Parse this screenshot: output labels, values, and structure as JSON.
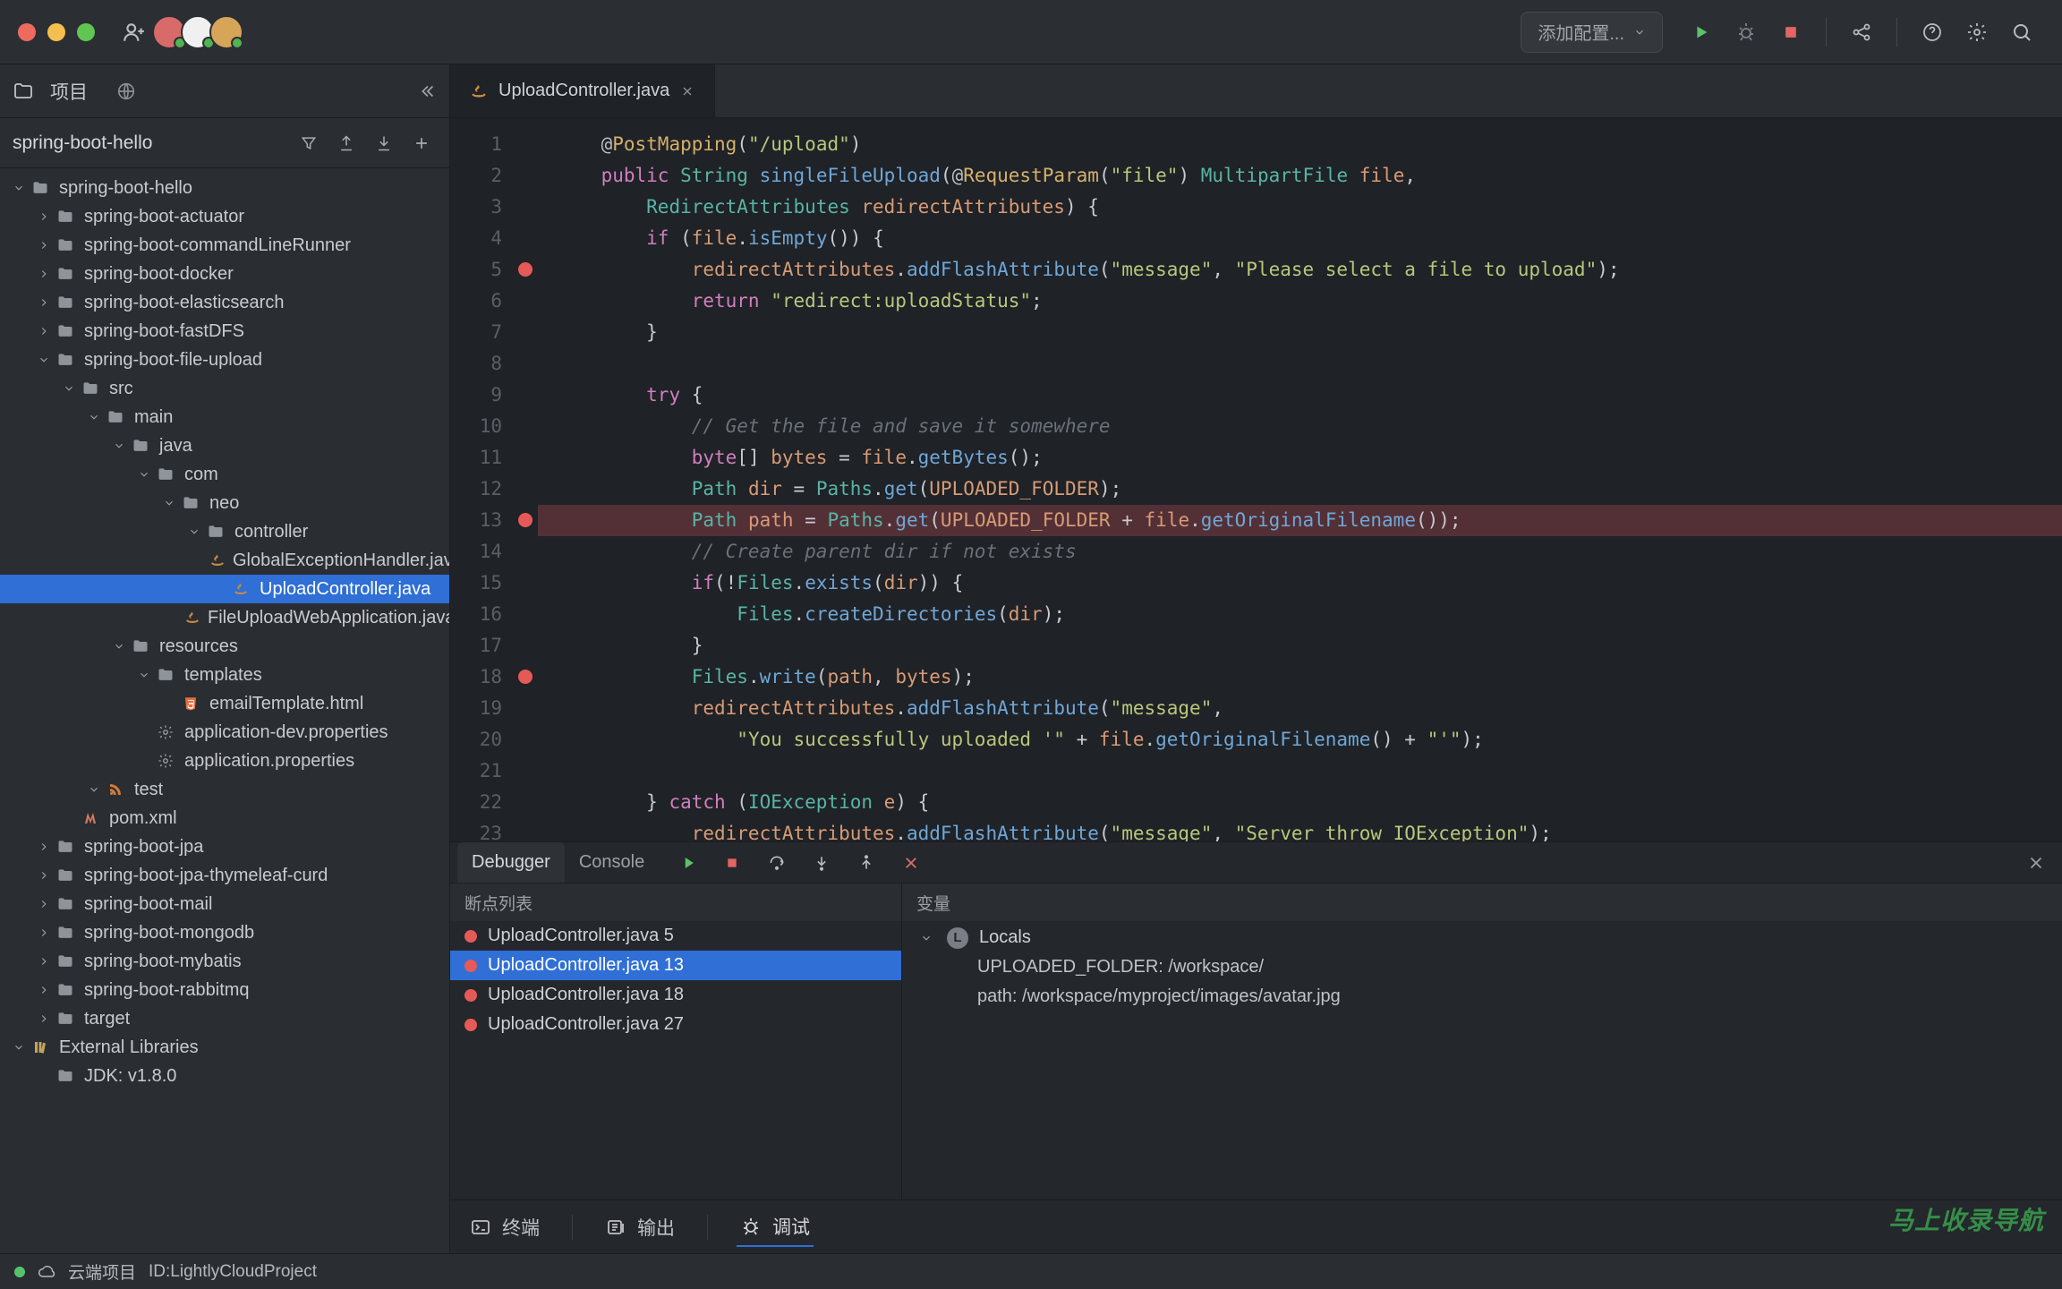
{
  "titlebar": {
    "runConfig": "添加配置..."
  },
  "sidebar": {
    "headerLabel": "项目",
    "breadcrumb": "spring-boot-hello"
  },
  "tree": [
    {
      "d": 0,
      "exp": true,
      "icon": "folder",
      "label": "spring-boot-hello"
    },
    {
      "d": 1,
      "exp": false,
      "icon": "folder",
      "label": "spring-boot-actuator"
    },
    {
      "d": 1,
      "exp": false,
      "icon": "folder",
      "label": "spring-boot-commandLineRunner"
    },
    {
      "d": 1,
      "exp": false,
      "icon": "folder",
      "label": "spring-boot-docker"
    },
    {
      "d": 1,
      "exp": false,
      "icon": "folder",
      "label": "spring-boot-elasticsearch"
    },
    {
      "d": 1,
      "exp": false,
      "icon": "folder",
      "label": "spring-boot-fastDFS"
    },
    {
      "d": 1,
      "exp": true,
      "icon": "folder",
      "label": "spring-boot-file-upload"
    },
    {
      "d": 2,
      "exp": true,
      "icon": "folder",
      "label": "src"
    },
    {
      "d": 3,
      "exp": true,
      "icon": "folder",
      "label": "main"
    },
    {
      "d": 4,
      "exp": true,
      "icon": "folder",
      "label": "java"
    },
    {
      "d": 5,
      "exp": true,
      "icon": "folder",
      "label": "com"
    },
    {
      "d": 6,
      "exp": true,
      "icon": "folder",
      "label": "neo"
    },
    {
      "d": 7,
      "exp": true,
      "icon": "folder",
      "label": "controller"
    },
    {
      "d": 8,
      "exp": null,
      "icon": "java",
      "label": "GlobalExceptionHandler.java"
    },
    {
      "d": 8,
      "exp": null,
      "icon": "java",
      "label": "UploadController.java",
      "sel": true
    },
    {
      "d": 7,
      "exp": null,
      "icon": "java",
      "label": "FileUploadWebApplication.java"
    },
    {
      "d": 4,
      "exp": true,
      "icon": "folder",
      "label": "resources"
    },
    {
      "d": 5,
      "exp": true,
      "icon": "folder",
      "label": "templates"
    },
    {
      "d": 6,
      "exp": null,
      "icon": "html5",
      "label": "emailTemplate.html"
    },
    {
      "d": 5,
      "exp": null,
      "icon": "gear",
      "label": "application-dev.properties"
    },
    {
      "d": 5,
      "exp": null,
      "icon": "gear",
      "label": "application.properties"
    },
    {
      "d": 3,
      "exp": true,
      "icon": "rss",
      "label": "test"
    },
    {
      "d": 2,
      "exp": null,
      "icon": "maven",
      "label": "pom.xml"
    },
    {
      "d": 1,
      "exp": false,
      "icon": "folder",
      "label": "spring-boot-jpa"
    },
    {
      "d": 1,
      "exp": false,
      "icon": "folder",
      "label": "spring-boot-jpa-thymeleaf-curd"
    },
    {
      "d": 1,
      "exp": false,
      "icon": "folder",
      "label": "spring-boot-mail"
    },
    {
      "d": 1,
      "exp": false,
      "icon": "folder",
      "label": "spring-boot-mongodb"
    },
    {
      "d": 1,
      "exp": false,
      "icon": "folder",
      "label": "spring-boot-mybatis"
    },
    {
      "d": 1,
      "exp": false,
      "icon": "folder",
      "label": "spring-boot-rabbitmq"
    },
    {
      "d": 1,
      "exp": false,
      "icon": "folder",
      "label": "target"
    },
    {
      "d": 0,
      "exp": true,
      "icon": "lib",
      "label": "External Libraries"
    },
    {
      "d": 1,
      "exp": null,
      "icon": "folder",
      "label": "JDK: v1.8.0"
    }
  ],
  "tab": {
    "label": "UploadController.java"
  },
  "code": {
    "startLine": 1,
    "highlightLine": 13,
    "breakpoints": [
      5,
      13,
      18
    ],
    "lines": [
      [
        [
          "    ",
          null
        ],
        [
          "@",
          null
        ],
        [
          "PostMapping",
          "ann"
        ],
        [
          "(",
          "pl"
        ],
        [
          "\"/upload\"",
          "str"
        ],
        [
          ")",
          "pl"
        ]
      ],
      [
        [
          "    ",
          null
        ],
        [
          "public ",
          "kw"
        ],
        [
          "String ",
          "type"
        ],
        [
          "singleFileUpload",
          "fn"
        ],
        [
          "(",
          "pl"
        ],
        [
          "@",
          null
        ],
        [
          "RequestParam",
          "ann"
        ],
        [
          "(",
          "pl"
        ],
        [
          "\"file\"",
          "str"
        ],
        [
          ") ",
          "pl"
        ],
        [
          "MultipartFile ",
          "type"
        ],
        [
          "file",
          "var"
        ],
        [
          ",",
          "pl"
        ]
      ],
      [
        [
          "        ",
          null
        ],
        [
          "RedirectAttributes ",
          "type"
        ],
        [
          "redirectAttributes",
          "var"
        ],
        [
          ") {",
          "pl"
        ]
      ],
      [
        [
          "        ",
          null
        ],
        [
          "if ",
          "kw"
        ],
        [
          "(",
          "pl"
        ],
        [
          "file",
          "var"
        ],
        [
          ".",
          "pl"
        ],
        [
          "isEmpty",
          "fn"
        ],
        [
          "()) {",
          "pl"
        ]
      ],
      [
        [
          "            ",
          null
        ],
        [
          "redirectAttributes",
          "var"
        ],
        [
          ".",
          "pl"
        ],
        [
          "addFlashAttribute",
          "fn"
        ],
        [
          "(",
          "pl"
        ],
        [
          "\"message\"",
          "str"
        ],
        [
          ", ",
          "pl"
        ],
        [
          "\"Please select a file to upload\"",
          "str"
        ],
        [
          ");",
          "pl"
        ]
      ],
      [
        [
          "            ",
          null
        ],
        [
          "return ",
          "kw"
        ],
        [
          "\"redirect:uploadStatus\"",
          "str"
        ],
        [
          ";",
          "pl"
        ]
      ],
      [
        [
          "        }",
          "pl"
        ]
      ],
      [
        [
          "",
          null
        ]
      ],
      [
        [
          "        ",
          null
        ],
        [
          "try ",
          "kw"
        ],
        [
          "{",
          "pl"
        ]
      ],
      [
        [
          "            ",
          null
        ],
        [
          "// Get the file and save it somewhere",
          "cm"
        ]
      ],
      [
        [
          "            ",
          null
        ],
        [
          "byte",
          "kw"
        ],
        [
          "[] ",
          "pl"
        ],
        [
          "bytes",
          "var"
        ],
        [
          " = ",
          "pl"
        ],
        [
          "file",
          "var"
        ],
        [
          ".",
          "pl"
        ],
        [
          "getBytes",
          "fn"
        ],
        [
          "();",
          "pl"
        ]
      ],
      [
        [
          "            ",
          null
        ],
        [
          "Path ",
          "type"
        ],
        [
          "dir",
          "var"
        ],
        [
          " = ",
          "pl"
        ],
        [
          "Paths",
          "type"
        ],
        [
          ".",
          "pl"
        ],
        [
          "get",
          "fn"
        ],
        [
          "(",
          "pl"
        ],
        [
          "UPLOADED_FOLDER",
          "var"
        ],
        [
          ");",
          "pl"
        ]
      ],
      [
        [
          "            ",
          null
        ],
        [
          "Path ",
          "type"
        ],
        [
          "path",
          "var"
        ],
        [
          " = ",
          "pl"
        ],
        [
          "Paths",
          "type"
        ],
        [
          ".",
          "pl"
        ],
        [
          "get",
          "fn"
        ],
        [
          "(",
          "pl"
        ],
        [
          "UPLOADED_FOLDER",
          "var"
        ],
        [
          " + ",
          "pl"
        ],
        [
          "file",
          "var"
        ],
        [
          ".",
          "pl"
        ],
        [
          "getOriginalFilename",
          "fn"
        ],
        [
          "());",
          "pl"
        ]
      ],
      [
        [
          "            ",
          null
        ],
        [
          "// Create parent dir if not exists",
          "cm"
        ]
      ],
      [
        [
          "            ",
          null
        ],
        [
          "if",
          "kw"
        ],
        [
          "(!",
          "pl"
        ],
        [
          "Files",
          "type"
        ],
        [
          ".",
          "pl"
        ],
        [
          "exists",
          "fn"
        ],
        [
          "(",
          "pl"
        ],
        [
          "dir",
          "var"
        ],
        [
          ")) {",
          "pl"
        ]
      ],
      [
        [
          "                ",
          null
        ],
        [
          "Files",
          "type"
        ],
        [
          ".",
          "pl"
        ],
        [
          "createDirectories",
          "fn"
        ],
        [
          "(",
          "pl"
        ],
        [
          "dir",
          "var"
        ],
        [
          ");",
          "pl"
        ]
      ],
      [
        [
          "            }",
          "pl"
        ]
      ],
      [
        [
          "            ",
          null
        ],
        [
          "Files",
          "type"
        ],
        [
          ".",
          "pl"
        ],
        [
          "write",
          "fn"
        ],
        [
          "(",
          "pl"
        ],
        [
          "path",
          "var"
        ],
        [
          ", ",
          "pl"
        ],
        [
          "bytes",
          "var"
        ],
        [
          ");",
          "pl"
        ]
      ],
      [
        [
          "            ",
          null
        ],
        [
          "redirectAttributes",
          "var"
        ],
        [
          ".",
          "pl"
        ],
        [
          "addFlashAttribute",
          "fn"
        ],
        [
          "(",
          "pl"
        ],
        [
          "\"message\"",
          "str"
        ],
        [
          ",",
          "pl"
        ]
      ],
      [
        [
          "                ",
          null
        ],
        [
          "\"You successfully uploaded '\"",
          "str"
        ],
        [
          " + ",
          "pl"
        ],
        [
          "file",
          "var"
        ],
        [
          ".",
          "pl"
        ],
        [
          "getOriginalFilename",
          "fn"
        ],
        [
          "() + ",
          "pl"
        ],
        [
          "\"'\"",
          "str"
        ],
        [
          ");",
          "pl"
        ]
      ],
      [
        [
          "",
          null
        ]
      ],
      [
        [
          "        } ",
          "pl"
        ],
        [
          "catch ",
          "kw"
        ],
        [
          "(",
          "pl"
        ],
        [
          "IOException ",
          "type"
        ],
        [
          "e",
          "var"
        ],
        [
          ") {",
          "pl"
        ]
      ],
      [
        [
          "            ",
          null
        ],
        [
          "redirectAttributes",
          "var"
        ],
        [
          ".",
          "pl"
        ],
        [
          "addFlashAttribute",
          "fn"
        ],
        [
          "(",
          "pl"
        ],
        [
          "\"message\"",
          "str"
        ],
        [
          ", ",
          "pl"
        ],
        [
          "\"Server throw IOException\"",
          "str"
        ],
        [
          ");",
          "pl"
        ]
      ]
    ]
  },
  "debug": {
    "tabs": {
      "debugger": "Debugger",
      "console": "Console"
    },
    "bpHeader": "断点列表",
    "varHeader": "变量",
    "breakpoints": [
      {
        "label": "UploadController.java 5",
        "sel": false
      },
      {
        "label": "UploadController.java 13",
        "sel": true
      },
      {
        "label": "UploadController.java 18",
        "sel": false
      },
      {
        "label": "UploadController.java 27",
        "sel": false
      }
    ],
    "locals": {
      "label": "Locals",
      "items": [
        "UPLOADED_FOLDER: /workspace/",
        "path: /workspace/myproject/images/avatar.jpg"
      ]
    }
  },
  "bottomTools": {
    "terminal": "终端",
    "output": "输出",
    "debug": "调试"
  },
  "statusbar": {
    "cloud": "云端项目",
    "id": "ID:LightlyCloudProject"
  },
  "watermark": "马上收录导航"
}
